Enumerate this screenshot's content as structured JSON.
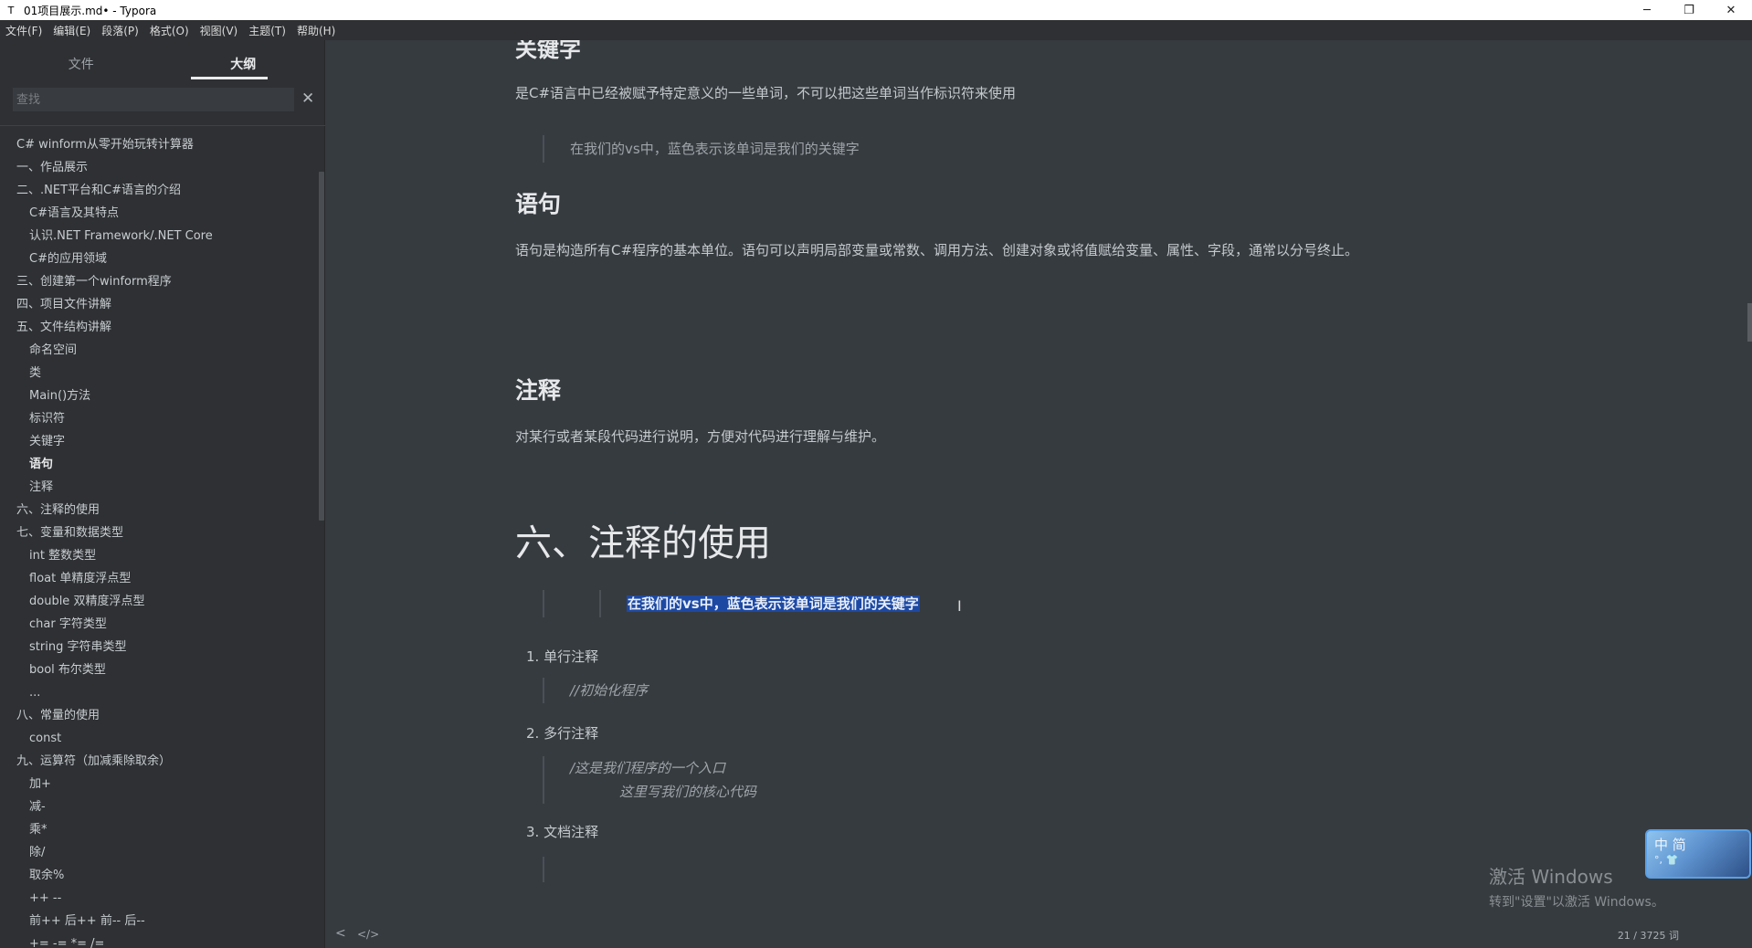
{
  "window": {
    "app_icon": "T",
    "title": "01项目展示.md• - Typora",
    "controls": [
      "─",
      "❐",
      "✕"
    ]
  },
  "menubar": {
    "items": [
      "文件(F)",
      "编辑(E)",
      "段落(P)",
      "格式(O)",
      "视图(V)",
      "主题(T)",
      "帮助(H)"
    ]
  },
  "sidebar": {
    "tabs": [
      "文件",
      "大纲"
    ],
    "active_tab": "大纲",
    "search_placeholder": "查找",
    "close_glyph": "✕",
    "outline": [
      {
        "label": "C# winform从零开始玩转计算器",
        "level": 1
      },
      {
        "label": "一、作品展示",
        "level": 1
      },
      {
        "label": "二、.NET平台和C#语言的介绍",
        "level": 1
      },
      {
        "label": "C#语言及其特点",
        "level": 2
      },
      {
        "label": "认识.NET Framework/.NET Core",
        "level": 2
      },
      {
        "label": "C#的应用领域",
        "level": 2
      },
      {
        "label": "三、创建第一个winform程序",
        "level": 1
      },
      {
        "label": "四、项目文件讲解",
        "level": 1
      },
      {
        "label": "五、文件结构讲解",
        "level": 1
      },
      {
        "label": "命名空间",
        "level": 2
      },
      {
        "label": "类",
        "level": 2
      },
      {
        "label": "Main()方法",
        "level": 2
      },
      {
        "label": "标识符",
        "level": 2
      },
      {
        "label": "关键字",
        "level": 2
      },
      {
        "label": "语句",
        "level": 2,
        "active": true
      },
      {
        "label": "注释",
        "level": 2
      },
      {
        "label": "六、注释的使用",
        "level": 1
      },
      {
        "label": "七、变量和数据类型",
        "level": 1
      },
      {
        "label": "int 整数类型",
        "level": 2
      },
      {
        "label": "float 单精度浮点型",
        "level": 2
      },
      {
        "label": "double 双精度浮点型",
        "level": 2
      },
      {
        "label": "char 字符类型",
        "level": 2
      },
      {
        "label": "string 字符串类型",
        "level": 2
      },
      {
        "label": "bool 布尔类型",
        "level": 2
      },
      {
        "label": "...",
        "level": 2
      },
      {
        "label": "八、常量的使用",
        "level": 1
      },
      {
        "label": "const",
        "level": 2
      },
      {
        "label": "九、运算符（加减乘除取余）",
        "level": 1
      },
      {
        "label": "加+",
        "level": 2
      },
      {
        "label": "减-",
        "level": 2
      },
      {
        "label": "乘*",
        "level": 2
      },
      {
        "label": "除/",
        "level": 2
      },
      {
        "label": "取余%",
        "level": 2
      },
      {
        "label": "++ --",
        "level": 2
      },
      {
        "label": "前++ 后++ 前-- 后--",
        "level": 2
      },
      {
        "label": "+= -= *= /=",
        "level": 2
      }
    ]
  },
  "editor": {
    "cut_heading": "关键字",
    "keyword_desc": "是C#语言中已经被赋予特定意义的一些单词，不可以把这些单词当作标识符来使用",
    "keyword_quote": "在我们的vs中，蓝色表示该单词是我们的关键字",
    "h_statement": "语句",
    "statement_desc": "语句是构造所有C#程序的基本单位。语句可以声明局部变量或常数、调用方法、创建对象或将值赋给变量、属性、字段，通常以分号终止。",
    "h_comment": "注释",
    "comment_desc": "对某行或者某段代码进行说明，方便对代码进行理解与维护。",
    "h1_comment_use": "六、注释的使用",
    "selected_quote": "在我们的vs中，蓝色表示该单词是我们的关键字",
    "list": [
      {
        "num": "1.",
        "label": "单行注释"
      },
      {
        "num": "2.",
        "label": "多行注释"
      },
      {
        "num": "3.",
        "label": "文档注释"
      }
    ],
    "single_line_quote": "//初始化程序",
    "multi_line_quote_1": "/这是我们程序的一个入口",
    "multi_line_quote_2": "这里写我们的核心代码"
  },
  "watermark": {
    "line1": "激活 Windows",
    "line2": "转到\"设置\"以激活 Windows。"
  },
  "ime": {
    "label1": "中",
    "label2": "简",
    "label3": "°, 👕"
  },
  "statusbar": {
    "back_glyph": "<",
    "source_glyph": "</>",
    "word_count": "21 / 3725 词"
  },
  "colors": {
    "background": "#363b40",
    "sidebar": "#2e3033",
    "selection": "#1d49a3",
    "text": "#c4c9ce"
  }
}
